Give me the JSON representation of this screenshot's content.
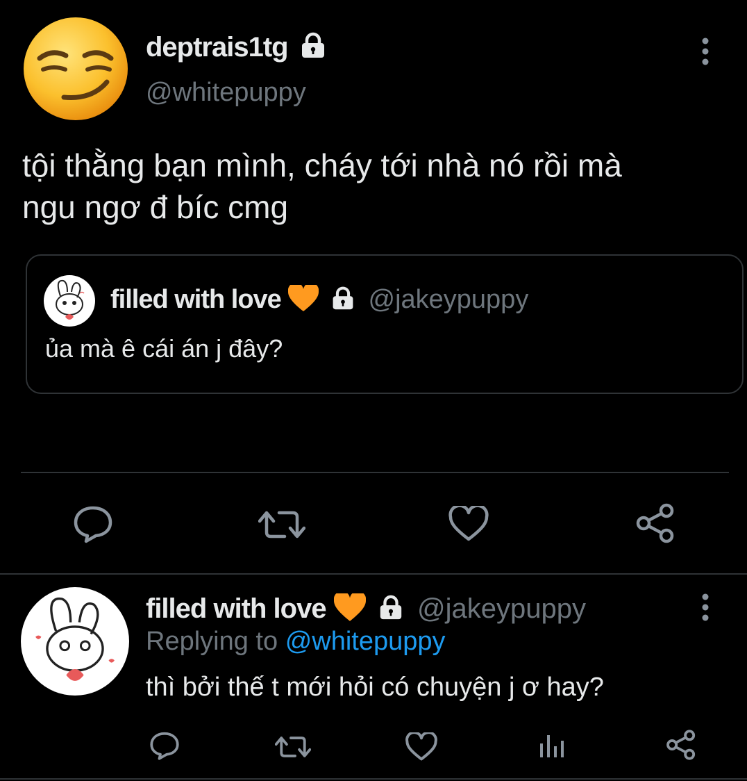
{
  "tweet": {
    "display_name": "deptrais1tg",
    "handle": "@whitepuppy",
    "text_line1": "tội thằng bạn mình, cháy tới nhà nó rồi mà",
    "text_line2": "ngu ngơ đ bíc cmg",
    "quote": {
      "display_name": "filled with love",
      "handle": "@jakeypuppy",
      "text": "ủa mà ê cái án j đây?"
    },
    "actions": [
      "reply-icon",
      "retweet-icon",
      "like-icon",
      "share-icon"
    ]
  },
  "reply": {
    "display_name": "filled with love",
    "handle": "@jakeypuppy",
    "replying_prefix": "Replying to",
    "replying_handle": "@whitepuppy",
    "text": "thì bởi thế t mới hỏi có chuyện j ơ hay?",
    "actions": [
      "reply-icon",
      "retweet-icon",
      "like-icon",
      "analytics-icon",
      "share-icon"
    ]
  },
  "colors": {
    "background": "#000000",
    "text": "#d9d9d9",
    "muted": "#6e767d",
    "link": "#1d9bf0",
    "heart_emoji": "#ff9a1f",
    "border": "#2f3336"
  }
}
